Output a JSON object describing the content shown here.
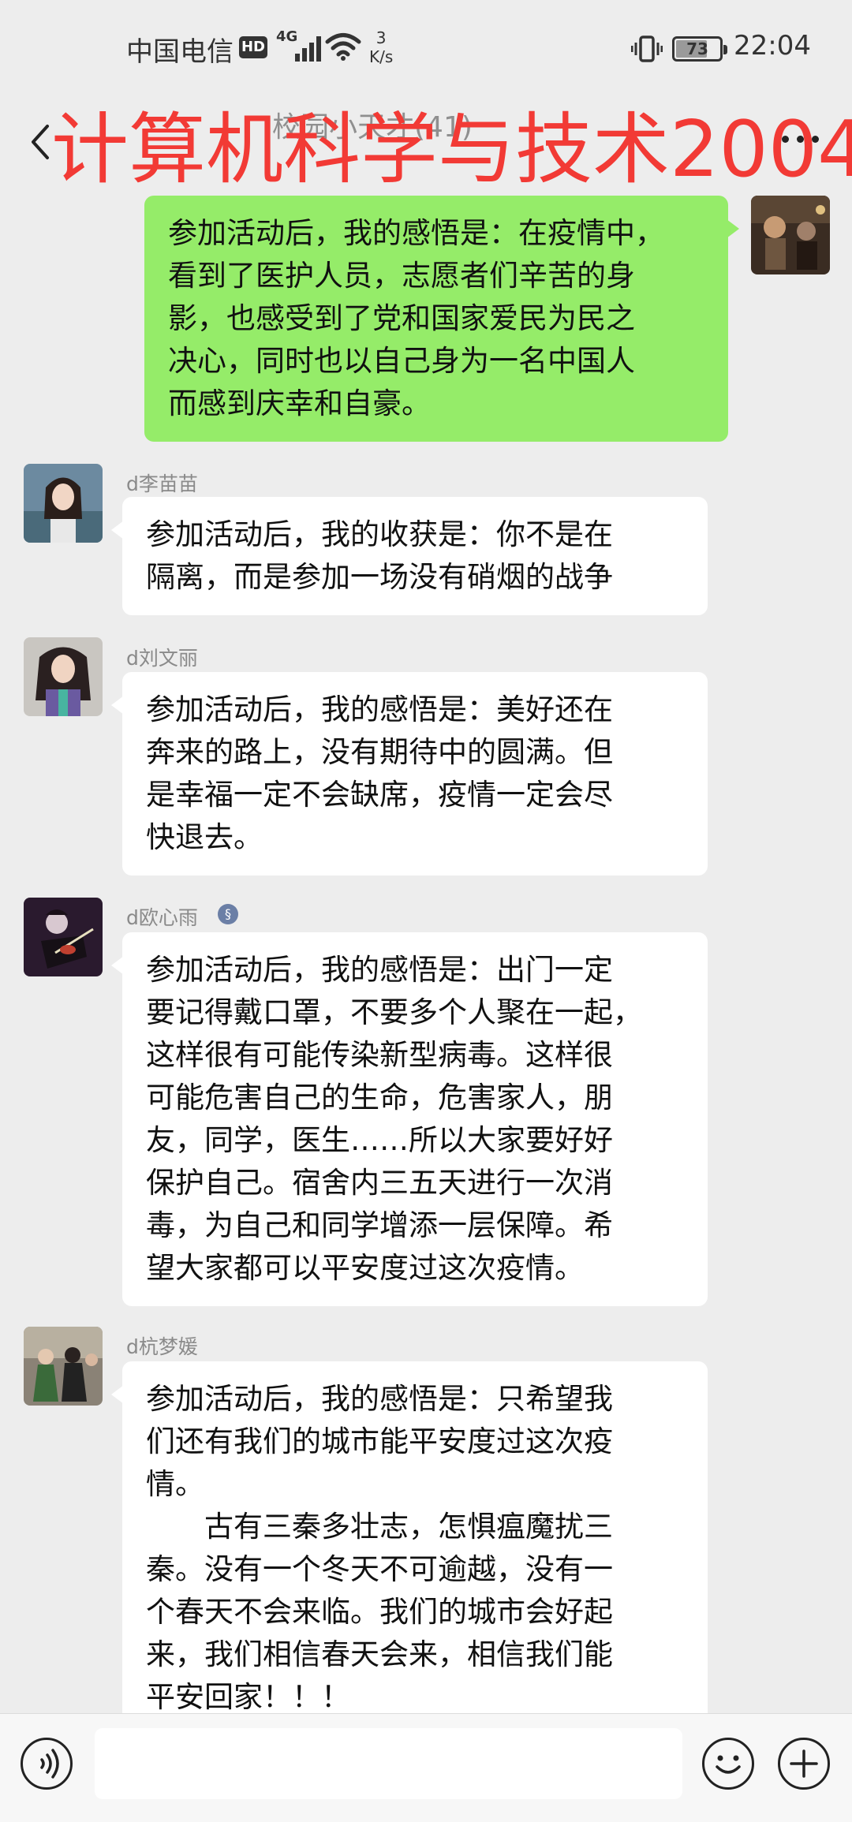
{
  "status_bar": {
    "carrier": "中国电信",
    "hd": "HD",
    "network": "4G",
    "speed_value": "3",
    "speed_unit": "K/s",
    "battery": "73",
    "battery_level": 0.73,
    "time": "22:04"
  },
  "header": {
    "chat_name": "校园小天才(41)",
    "overlay_title": "计算机科学与技术2004"
  },
  "messages": [
    {
      "direction": "out",
      "sender": "",
      "lines": [
        "参加活动后，我的感悟是：在疫情中，",
        "看到了医护人员，志愿者们辛苦的身",
        "影，也感受到了党和国家爱民为民之",
        "决心，同时也以自己身为一名中国人",
        "而感到庆幸和自豪。"
      ]
    },
    {
      "direction": "in",
      "sender": "d李苗苗",
      "lines": [
        "参加活动后，我的收获是：你不是在",
        "隔离，而是参加一场没有硝烟的战争"
      ]
    },
    {
      "direction": "in",
      "sender": "d刘文丽",
      "lines": [
        "参加活动后，我的感悟是：美好还在",
        "奔来的路上，没有期待中的圆满。但",
        "是幸福一定不会缺席，疫情一定会尽",
        "快退去。"
      ]
    },
    {
      "direction": "in",
      "sender": "d欧心雨",
      "badge": "§",
      "lines": [
        "参加活动后，我的感悟是：出门一定",
        "要记得戴口罩，不要多个人聚在一起，",
        "这样很有可能传染新型病毒。这样很",
        "可能危害自己的生命，危害家人，朋",
        "友，同学，医生……所以大家要好好",
        "保护自己。宿舍内三五天进行一次消",
        "毒，为自己和同学增添一层保障。希",
        "望大家都可以平安度过这次疫情。"
      ]
    },
    {
      "direction": "in",
      "sender": "d杭梦媛",
      "lines": [
        "参加活动后，我的感悟是：只希望我",
        "们还有我们的城市能平安度过这次疫",
        "情。",
        "　　古有三秦多壮志，怎惧瘟魔扰三",
        "秦。没有一个冬天不可逾越，没有一",
        "个春天不会来临。我们的城市会好起",
        "来，我们相信春天会来，相信我们能",
        "平安回家！！！"
      ]
    }
  ],
  "input_bar": {
    "placeholder": "",
    "voice_icon": "voice-icon",
    "emoji_icon": "emoji-icon",
    "plus_icon": "plus-icon"
  },
  "colors": {
    "background": "#ededed",
    "outgoing_bubble": "#95ec69",
    "incoming_bubble": "#ffffff",
    "overlay_text": "#f23a35"
  }
}
